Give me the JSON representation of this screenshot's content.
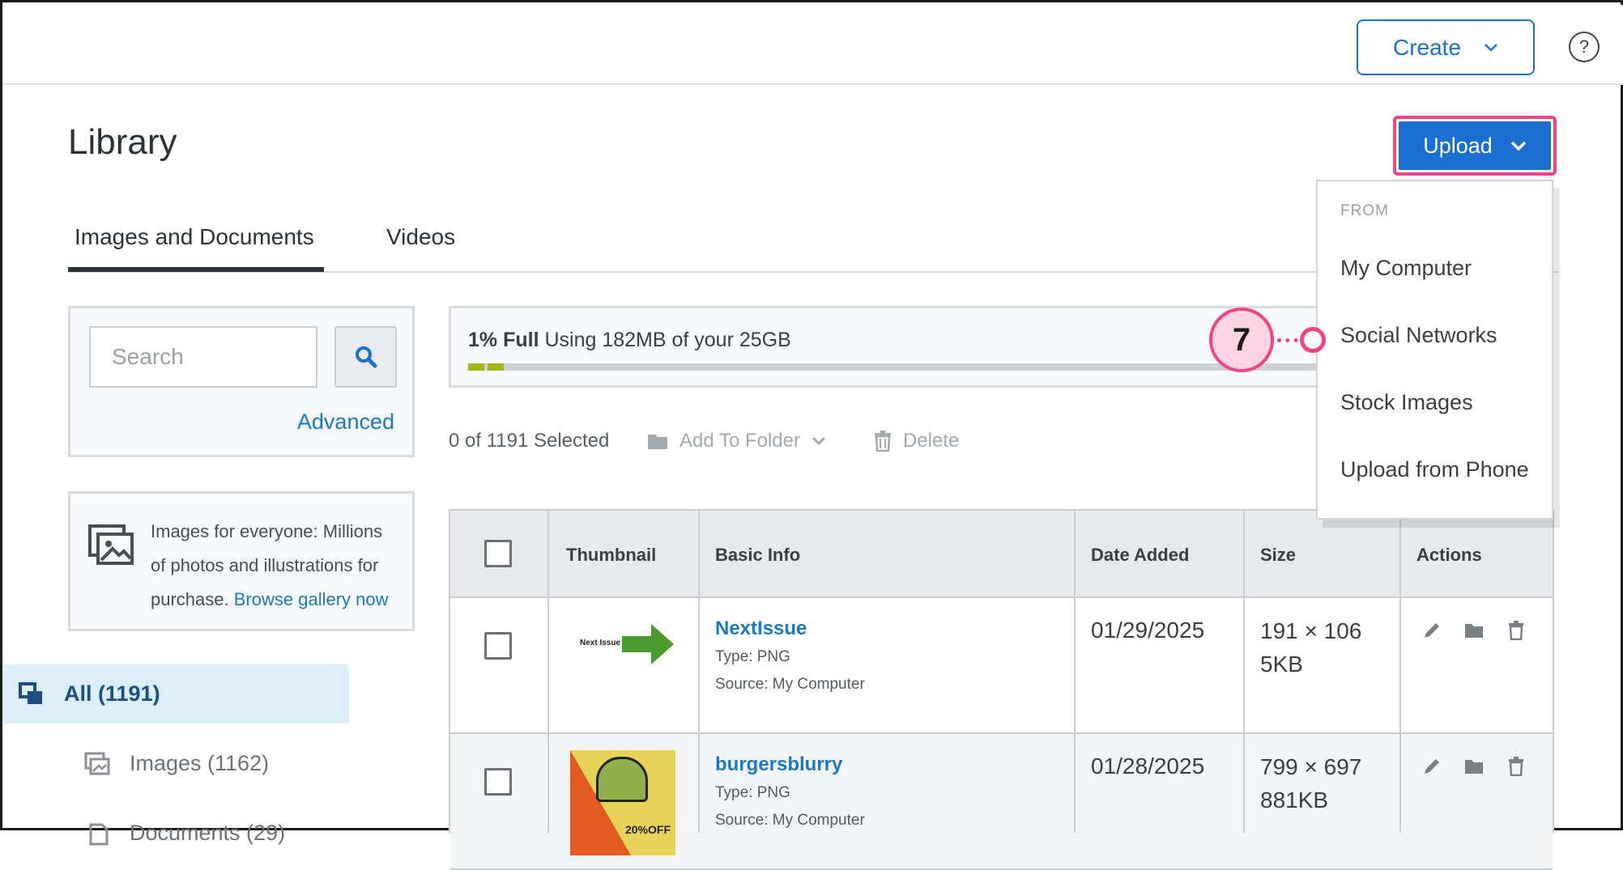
{
  "topbar": {
    "create_label": "Create",
    "help_glyph": "?"
  },
  "page": {
    "title": "Library"
  },
  "upload": {
    "label": "Upload",
    "menu": {
      "header": "FROM",
      "items": [
        "My Computer",
        "Social Networks",
        "Stock Images",
        "Upload from Phone"
      ]
    }
  },
  "tabs": [
    {
      "label": "Images and Documents",
      "active": true
    },
    {
      "label": "Videos",
      "active": false
    }
  ],
  "search": {
    "placeholder": "Search",
    "advanced_label": "Advanced"
  },
  "promo": {
    "text": "Images for everyone: Millions of photos and illustrations for purchase.",
    "link": "Browse gallery now"
  },
  "sidebar": {
    "items": [
      {
        "label": "All (1191)",
        "active": true
      },
      {
        "label": "Images (1162)",
        "active": false
      },
      {
        "label": "Documents (29)",
        "active": false
      }
    ]
  },
  "storage": {
    "percent_label": "1% Full",
    "usage_text": "Using 182MB of your 25GB",
    "fill_fraction": 0.01,
    "fill_color": "#a5b41a"
  },
  "toolbar": {
    "selected_count": "0 of 1191 Selected",
    "add_to_folder": "Add To Folder",
    "delete": "Delete"
  },
  "table": {
    "headers": [
      "Thumbnail",
      "Basic Info",
      "Date Added",
      "Size",
      "Actions"
    ],
    "rows": [
      {
        "name": "NextIssue",
        "type": "Type: PNG",
        "source": "Source: My Computer",
        "date": "01/29/2025",
        "dimensions": "191 × 106",
        "filesize": "5KB",
        "thumb_text": "Next Issue"
      },
      {
        "name": "burgersblurry",
        "type": "Type: PNG",
        "source": "Source: My Computer",
        "date": "01/28/2025",
        "dimensions": "799 × 697",
        "filesize": "881KB",
        "thumb_text": "20%OFF"
      }
    ]
  },
  "annotation": {
    "step": "7"
  },
  "colors": {
    "primary": "#1a6fd0",
    "highlight": "#f0438a",
    "link": "#1a7ac2"
  }
}
